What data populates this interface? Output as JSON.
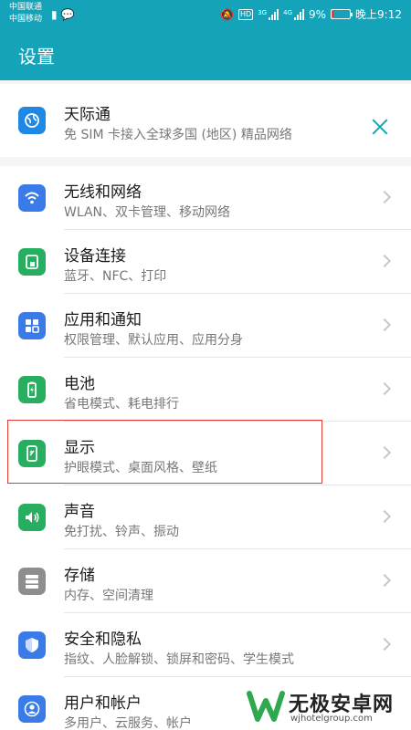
{
  "status_bar": {
    "carrier1": "中国联通",
    "carrier2": "中国移动",
    "hd": "HD",
    "sig1_label": "3G",
    "sig2_label": "4G",
    "battery_pct": "9%",
    "time": "晚上9:12"
  },
  "header": {
    "title": "设置"
  },
  "promo": {
    "title": "天际通",
    "subtitle": "免 SIM 卡接入全球多国 (地区) 精品网络",
    "icon": "globe-icon"
  },
  "items": [
    {
      "title": "无线和网络",
      "subtitle": "WLAN、双卡管理、移动网络",
      "icon": "wifi-icon",
      "color": "#3b7be8"
    },
    {
      "title": "设备连接",
      "subtitle": "蓝牙、NFC、打印",
      "icon": "device-connect-icon",
      "color": "#27ae60"
    },
    {
      "title": "应用和通知",
      "subtitle": "权限管理、默认应用、应用分身",
      "icon": "apps-icon",
      "color": "#3b7be8"
    },
    {
      "title": "电池",
      "subtitle": "省电模式、耗电排行",
      "icon": "battery-icon",
      "color": "#27ae60"
    },
    {
      "title": "显示",
      "subtitle": "护眼模式、桌面风格、壁纸",
      "icon": "display-icon",
      "color": "#27ae60"
    },
    {
      "title": "声音",
      "subtitle": "免打扰、铃声、振动",
      "icon": "speaker-icon",
      "color": "#27ae60"
    },
    {
      "title": "存储",
      "subtitle": "内存、空间清理",
      "icon": "storage-icon",
      "color": "#8e8e8e"
    },
    {
      "title": "安全和隐私",
      "subtitle": "指纹、人脸解锁、锁屏和密码、学生模式",
      "icon": "shield-icon",
      "color": "#3b7be8"
    },
    {
      "title": "用户和帐户",
      "subtitle": "多用户、云服务、帐户",
      "icon": "user-icon",
      "color": "#3b7be8"
    }
  ],
  "watermark": {
    "title": "无极安卓网",
    "url": "wjhotelgroup.com"
  }
}
